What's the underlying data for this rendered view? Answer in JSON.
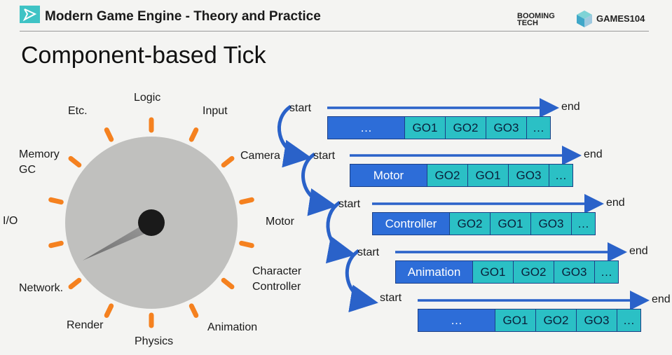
{
  "header": {
    "title": "Modern Game Engine - Theory and Practice",
    "brand_left_line1": "BOOMING",
    "brand_left_line2": "TECH",
    "brand_right": "GAMES104"
  },
  "slide_title": "Component-based Tick",
  "dial": {
    "labels": {
      "logic": "Logic",
      "etc": "Etc.",
      "input": "Input",
      "memory_gc_1": "Memory",
      "memory_gc_2": "GC",
      "camera": "Camera",
      "io": "I/O",
      "motor": "Motor",
      "network": "Network.",
      "character_controller_1": "Character",
      "character_controller_2": "Controller",
      "render": "Render",
      "animation": "Animation",
      "physics": "Physics"
    },
    "colors": {
      "dial_fill": "#c0c0be",
      "tick": "#f5811f",
      "hub": "#1a1a1a"
    }
  },
  "timeline": {
    "start_label": "start",
    "end_label": "end",
    "rows": [
      {
        "cells": [
          "…",
          "GO1",
          "GO2",
          "GO3",
          "…"
        ]
      },
      {
        "cells": [
          "Motor",
          "GO2",
          "GO1",
          "GO3",
          "…"
        ]
      },
      {
        "cells": [
          "Controller",
          "GO2",
          "GO1",
          "GO3",
          "…"
        ]
      },
      {
        "cells": [
          "Animation",
          "GO1",
          "GO2",
          "GO3",
          "…"
        ]
      },
      {
        "cells": [
          "…",
          "GO1",
          "GO2",
          "GO3",
          "…"
        ]
      }
    ],
    "colors": {
      "active": "#2d6dd8",
      "object": "#2bc0c5",
      "arrow": "#2a62c9"
    }
  }
}
